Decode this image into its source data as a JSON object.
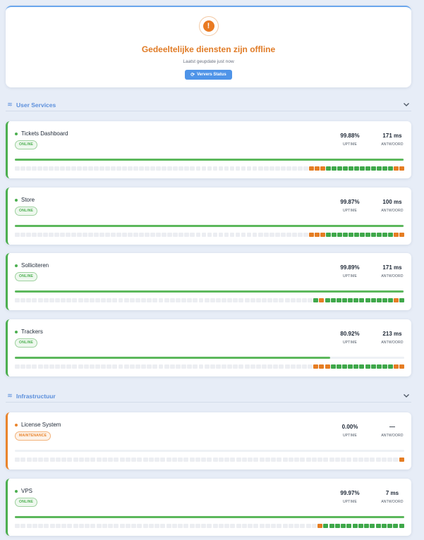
{
  "banner": {
    "title": "Gedeeltelijke diensten zijn offline",
    "updated": "Laatst geupdate just now",
    "refresh_label": "Ververs Status",
    "accent": "#e07b26"
  },
  "sections": [
    {
      "title": "User Services",
      "services": [
        {
          "name": "Tickets Dashboard",
          "status": "ONLINE",
          "uptime": "99.88%",
          "uptime_label": "UPTIME",
          "response": "171 ms",
          "response_label": "ANTWOORD",
          "uptime_fraction": 0.9988,
          "history": "....................................................wwwooooooooooooww"
        },
        {
          "name": "Store",
          "status": "ONLINE",
          "uptime": "99.87%",
          "uptime_label": "UPTIME",
          "response": "100 ms",
          "response_label": "ANTWOORD",
          "uptime_fraction": 0.9987,
          "history": "....................................................wwwooooooooooooww"
        },
        {
          "name": "Solliciteren",
          "status": "ONLINE",
          "uptime": "99.89%",
          "uptime_label": "UPTIME",
          "response": "171 ms",
          "response_label": "ANTWOORD",
          "uptime_fraction": 0.9989,
          "history": "....................................................owoooooooooooowo"
        },
        {
          "name": "Trackers",
          "status": "ONLINE",
          "uptime": "80.92%",
          "uptime_label": "UPTIME",
          "response": "213 ms",
          "response_label": "ANTWOORD",
          "uptime_fraction": 0.8092,
          "history": "....................................................wwwoooooooooooww"
        }
      ]
    },
    {
      "title": "Infrastructuur",
      "services": [
        {
          "name": "License System",
          "status": "MAINTENANCE",
          "uptime": "0.00%",
          "uptime_label": "UPTIME",
          "response": "—",
          "response_label": "ANTWOORD",
          "uptime_fraction": 0,
          "history": "..................................................................w"
        },
        {
          "name": "VPS",
          "status": "ONLINE",
          "uptime": "99.97%",
          "uptime_label": "UPTIME",
          "response": "7 ms",
          "response_label": "ANTWOORD",
          "uptime_fraction": 0.9997,
          "history": "....................................................woooooooooooooo"
        }
      ]
    }
  ],
  "colors": {
    "online": "#4caf50",
    "maintenance": "#e9842c",
    "section_title": "#5b8fdc",
    "refresh_button": "#4f94e8"
  },
  "icons": {
    "banner": "exclamation-icon",
    "refresh": "refresh-icon",
    "section": "layers-icon",
    "collapse": "chevron-down-icon"
  }
}
